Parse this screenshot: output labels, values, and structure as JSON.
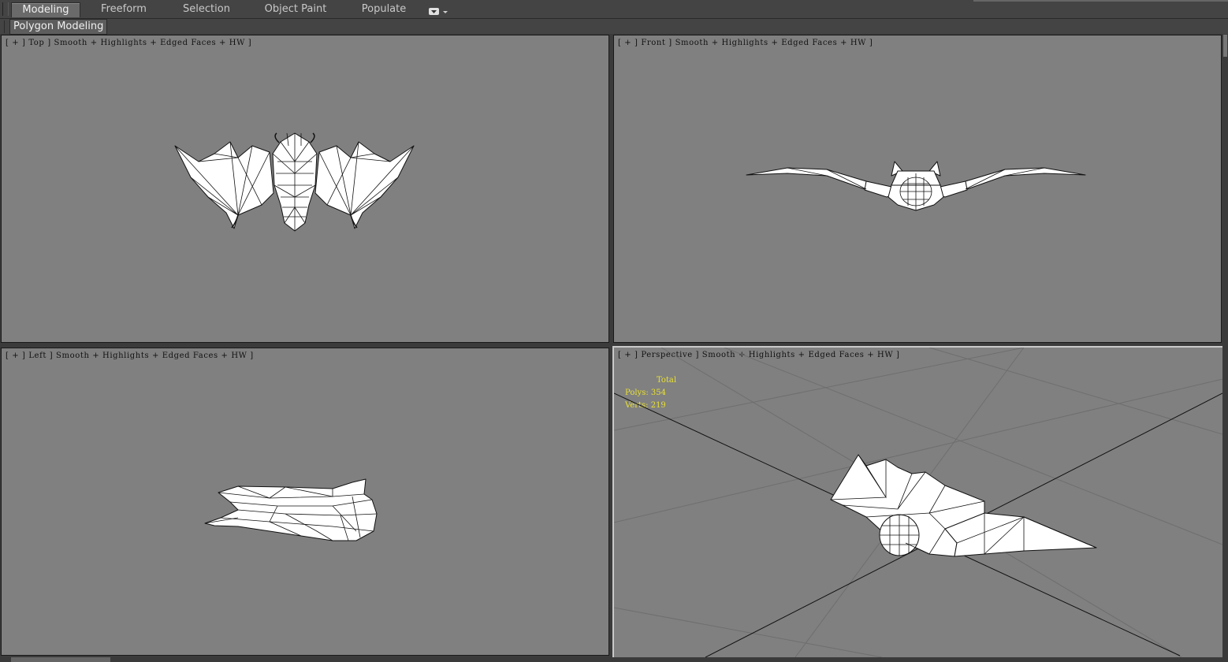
{
  "ribbon": {
    "tabs": [
      {
        "label": "Modeling",
        "active": true
      },
      {
        "label": "Freeform",
        "active": false
      },
      {
        "label": "Selection",
        "active": false
      },
      {
        "label": "Object Paint",
        "active": false
      },
      {
        "label": "Populate",
        "active": false
      }
    ],
    "dropdown_icon": "display-options-icon",
    "panel_tab": "Polygon Modeling"
  },
  "viewports": {
    "top": {
      "label": "[ + ] Top ] Smooth + Highlights + Edged Faces + HW ]"
    },
    "front": {
      "label": "[ + ] Front ] Smooth + Highlights + Edged Faces + HW ]"
    },
    "left": {
      "label": "[ + ] Left ] Smooth + Highlights + Edged Faces + HW ]"
    },
    "perspective": {
      "label": "[ + ] Perspective ] Smooth + Highlights + Edged Faces + HW ]"
    }
  },
  "statistics": {
    "total_label": "Total",
    "polys": "Polys: 354",
    "verts": "Verts: 219"
  },
  "colors": {
    "viewport_bg": "#808080",
    "ui_bg": "#444444",
    "stats_text": "#e8e033",
    "mesh_fill": "#ffffff",
    "mesh_edge": "#111111"
  }
}
